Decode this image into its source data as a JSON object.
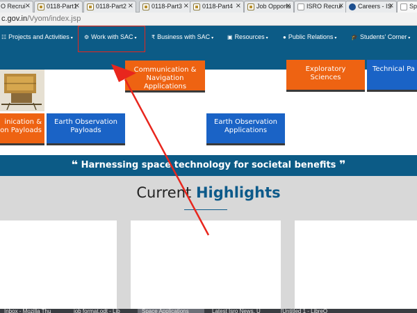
{
  "browser": {
    "tabs": [
      {
        "title": "O Recrui",
        "favicon": "isro-logo-icon"
      },
      {
        "title": "0118-Part1",
        "favicon": "document-icon"
      },
      {
        "title": "0118-Part2",
        "favicon": "document-icon"
      },
      {
        "title": "0118-Part3",
        "favicon": "document-icon"
      },
      {
        "title": "0118-Part4",
        "favicon": "document-icon"
      },
      {
        "title": "Job Opportu",
        "favicon": "document-icon"
      },
      {
        "title": "ISRO Recrui",
        "favicon": "page-icon"
      },
      {
        "title": "Careers - IS",
        "favicon": "isro-logo-icon"
      },
      {
        "title": "Spa",
        "favicon": "page-icon"
      }
    ],
    "close_glyph": "×",
    "address": {
      "domain": "c.gov.in",
      "path": "/Vyom/index.jsp"
    }
  },
  "nav": {
    "items": [
      {
        "label": "Projects and Activities",
        "icon": "☷"
      },
      {
        "label": "Work with SAC",
        "icon": "⚙"
      },
      {
        "label": "Business with SAC",
        "icon": "₹"
      },
      {
        "label": "Resources",
        "icon": "▣"
      },
      {
        "label": "Public Relations",
        "icon": "●"
      },
      {
        "label": "Students' Corner",
        "icon": "🎓"
      }
    ],
    "caret": "▾"
  },
  "tiles": {
    "communication_nav": [
      "Communication &",
      "Navigation",
      "Applications"
    ],
    "exploratory": [
      "Exploratory",
      "Sciences"
    ],
    "technical": [
      "Technical Pa"
    ],
    "comm_payloads": [
      "inication &",
      "on Payloads"
    ],
    "eo_payloads": [
      "Earth Observation",
      "Payloads"
    ],
    "eo_applications": [
      "Earth Observation",
      "Applications"
    ]
  },
  "tagline": {
    "open_quote": "❝",
    "text": "Harnessing space technology for societal benefits",
    "close_quote": "❞"
  },
  "highlights": {
    "title_plain": "Current",
    "title_accent": "Highlights"
  },
  "taskbar": {
    "items": [
      {
        "label": "Inbox - Mozilla Thu"
      },
      {
        "label": "job format.odt - Lib"
      },
      {
        "label": "Space Applications"
      },
      {
        "label": "Latest Isro News, U"
      },
      {
        "label": "[Untitled 1 - LibreO"
      }
    ]
  },
  "colors": {
    "header_blue": "#0c5b86",
    "tile_orange": "#ee6312",
    "tile_blue": "#1a63c6",
    "annotation_red": "#e8261d",
    "section_gray": "#d8d8d8"
  }
}
